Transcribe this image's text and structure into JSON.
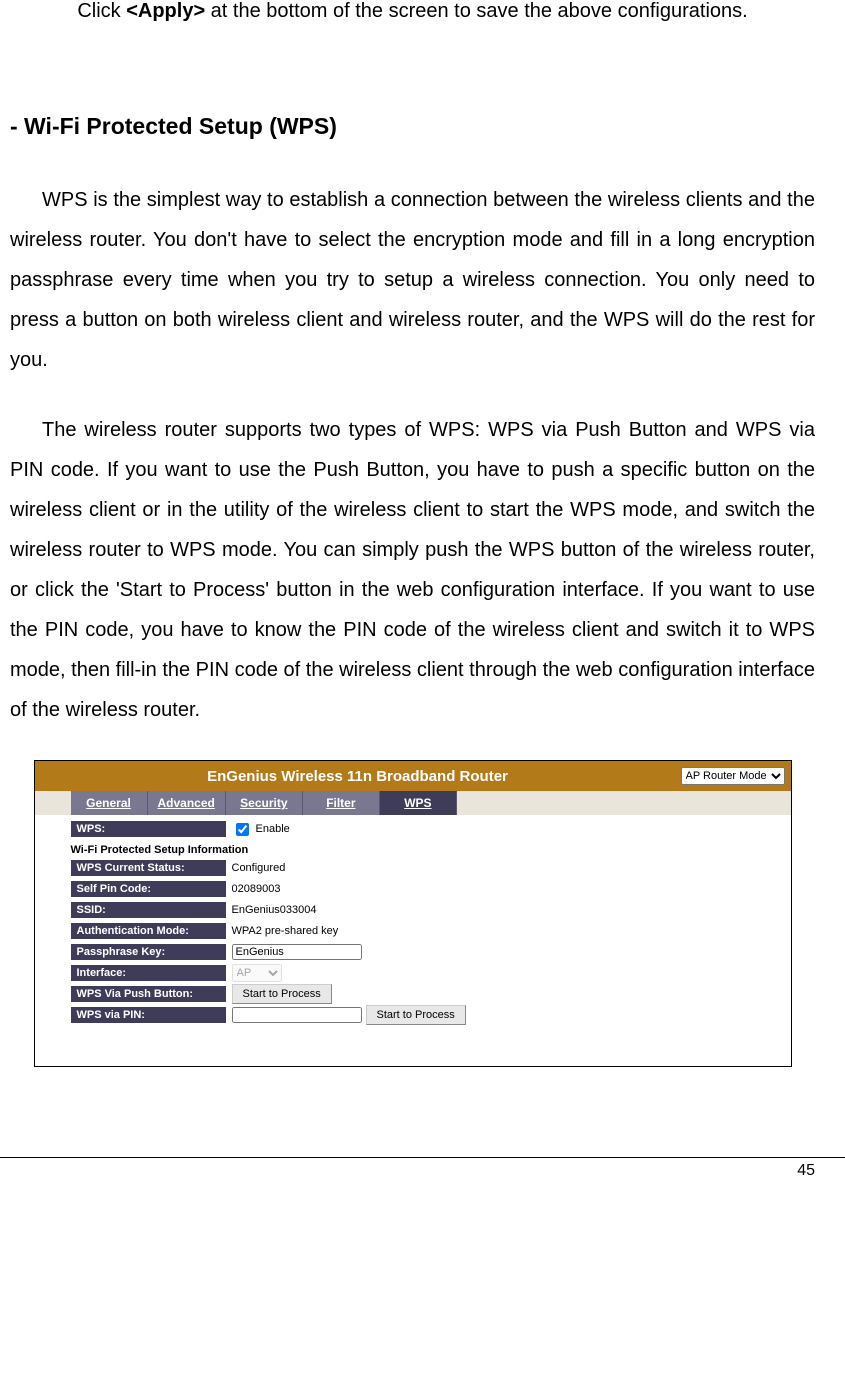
{
  "intro": {
    "prefix": "Click ",
    "bold": "<Apply>",
    "suffix": " at the bottom of the screen to save the above configurations."
  },
  "heading": "- Wi-Fi Protected Setup (WPS)",
  "para1": "WPS is the simplest way to establish a connection between the wireless clients and the wireless router. You don't have to select the encryption mode and fill in a long encryption passphrase every time when you try to setup a wireless connection. You only need to press a button on both wireless client and wireless router, and the WPS will do the rest for you.",
  "para2": "The wireless router supports two types of WPS: WPS via Push Button and WPS via PIN code. If you want to use the Push Button, you have to push a specific button on the wireless client or in the utility of the wireless client to start the WPS mode, and switch the wireless router to WPS mode. You can simply push the WPS button of the wireless router, or click the 'Start to Process' button in the web configuration interface. If you want to use the PIN code, you have to know the PIN code of the wireless client and switch it to WPS mode, then fill-in the PIN code of the wireless client through the web configuration interface of the wireless router.",
  "router": {
    "title": "EnGenius Wireless 11n Broadband Router",
    "mode_selected": "AP Router Mode",
    "tabs": {
      "general": "General",
      "advanced": "Advanced",
      "security": "Security",
      "filter": "Filter",
      "wps": "WPS"
    },
    "labels": {
      "wps": "WPS:",
      "enable": "Enable",
      "section_info": "Wi-Fi Protected Setup Information",
      "status": "WPS Current Status:",
      "status_val": "Configured",
      "selfpin": "Self Pin Code:",
      "selfpin_val": "02089003",
      "ssid": "SSID:",
      "ssid_val": "EnGenius033004",
      "auth": "Authentication Mode:",
      "auth_val": "WPA2 pre-shared key",
      "pass": "Passphrase Key:",
      "pass_val": "EnGenius",
      "iface": "Interface:",
      "iface_val": "AP",
      "push": "WPS Via Push Button:",
      "pin": "WPS via PIN:",
      "start": "Start to Process"
    }
  },
  "page_number": "45"
}
